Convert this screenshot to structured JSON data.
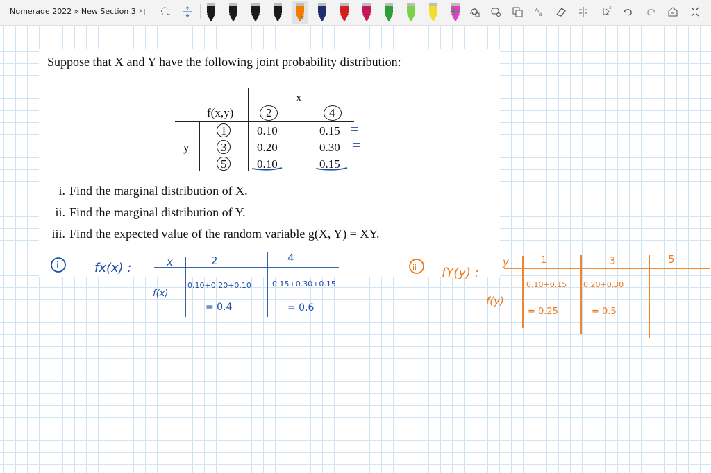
{
  "window": {
    "title": "Numerade 2022 » New Section 3"
  },
  "toolbar": {
    "tools": [
      "select-text-icon",
      "lasso-icon",
      "insert-space-icon"
    ],
    "pens": [
      {
        "name": "pen-black-1",
        "color": "#1a1a1a"
      },
      {
        "name": "pen-black-2",
        "color": "#1a1a1a"
      },
      {
        "name": "pen-black-3",
        "color": "#1a1a1a"
      },
      {
        "name": "pen-black-4",
        "color": "#1a1a1a"
      },
      {
        "name": "pen-orange",
        "color": "#f07d00",
        "selected": true
      },
      {
        "name": "pen-navy-1",
        "color": "#1f2d6b"
      },
      {
        "name": "pen-red",
        "color": "#d21f1f"
      },
      {
        "name": "pen-magenta",
        "color": "#c2185b"
      },
      {
        "name": "pen-green-1",
        "color": "#2e9e3a"
      },
      {
        "name": "pen-green-2",
        "color": "#7ad14a"
      },
      {
        "name": "pen-yellow",
        "color": "#f4dc2a"
      },
      {
        "name": "pen-pink",
        "color": "#e040c8"
      }
    ],
    "add_pen": "+",
    "actions": [
      "ink-to-shape-icon",
      "lasso-select-icon",
      "ink-to-text-icon",
      "ink-to-math-icon",
      "eraser-icon",
      "ruler-icon",
      "replay-icon",
      "undo-icon",
      "redo-icon",
      "fullscreen-icon",
      "collapse-icon"
    ]
  },
  "document": {
    "intro": "Suppose that X and Y have the following joint probability distribution:",
    "table": {
      "corner": "f(x,y)",
      "x_label": "x",
      "y_label": "y",
      "x_values": [
        "2",
        "4"
      ],
      "y_values": [
        "1",
        "3",
        "5"
      ],
      "rows": [
        [
          "0.10",
          "0.15"
        ],
        [
          "0.20",
          "0.30"
        ],
        [
          "0.10",
          "0.15"
        ]
      ]
    },
    "questions": [
      {
        "num": "i.",
        "text": "Find the marginal distribution of X."
      },
      {
        "num": "ii.",
        "text": "Find the marginal distribution of Y."
      },
      {
        "num": "iii.",
        "text": "Find the expected value of the random variable g(X, Y) = XY."
      }
    ]
  },
  "handwriting": {
    "blue": {
      "marker": "i",
      "func": "fx(x) :",
      "x": "x",
      "fx": "f(x)",
      "v2": "2",
      "v4": "4",
      "sum1": "0.10+0.20+0.10",
      "sum2": "0.15+0.30+0.15",
      "res1": "= 0.4",
      "res2": "= 0.6"
    },
    "orange": {
      "marker": "ii",
      "func": "fY(y) :",
      "y": "y",
      "fy": "f(y)",
      "v1": "1",
      "v3": "3",
      "v5": "5",
      "sum1": "0.10+0.15",
      "sum2": "0.20+0.30",
      "res1": "= 0.25",
      "res2": "= 0.5"
    }
  }
}
